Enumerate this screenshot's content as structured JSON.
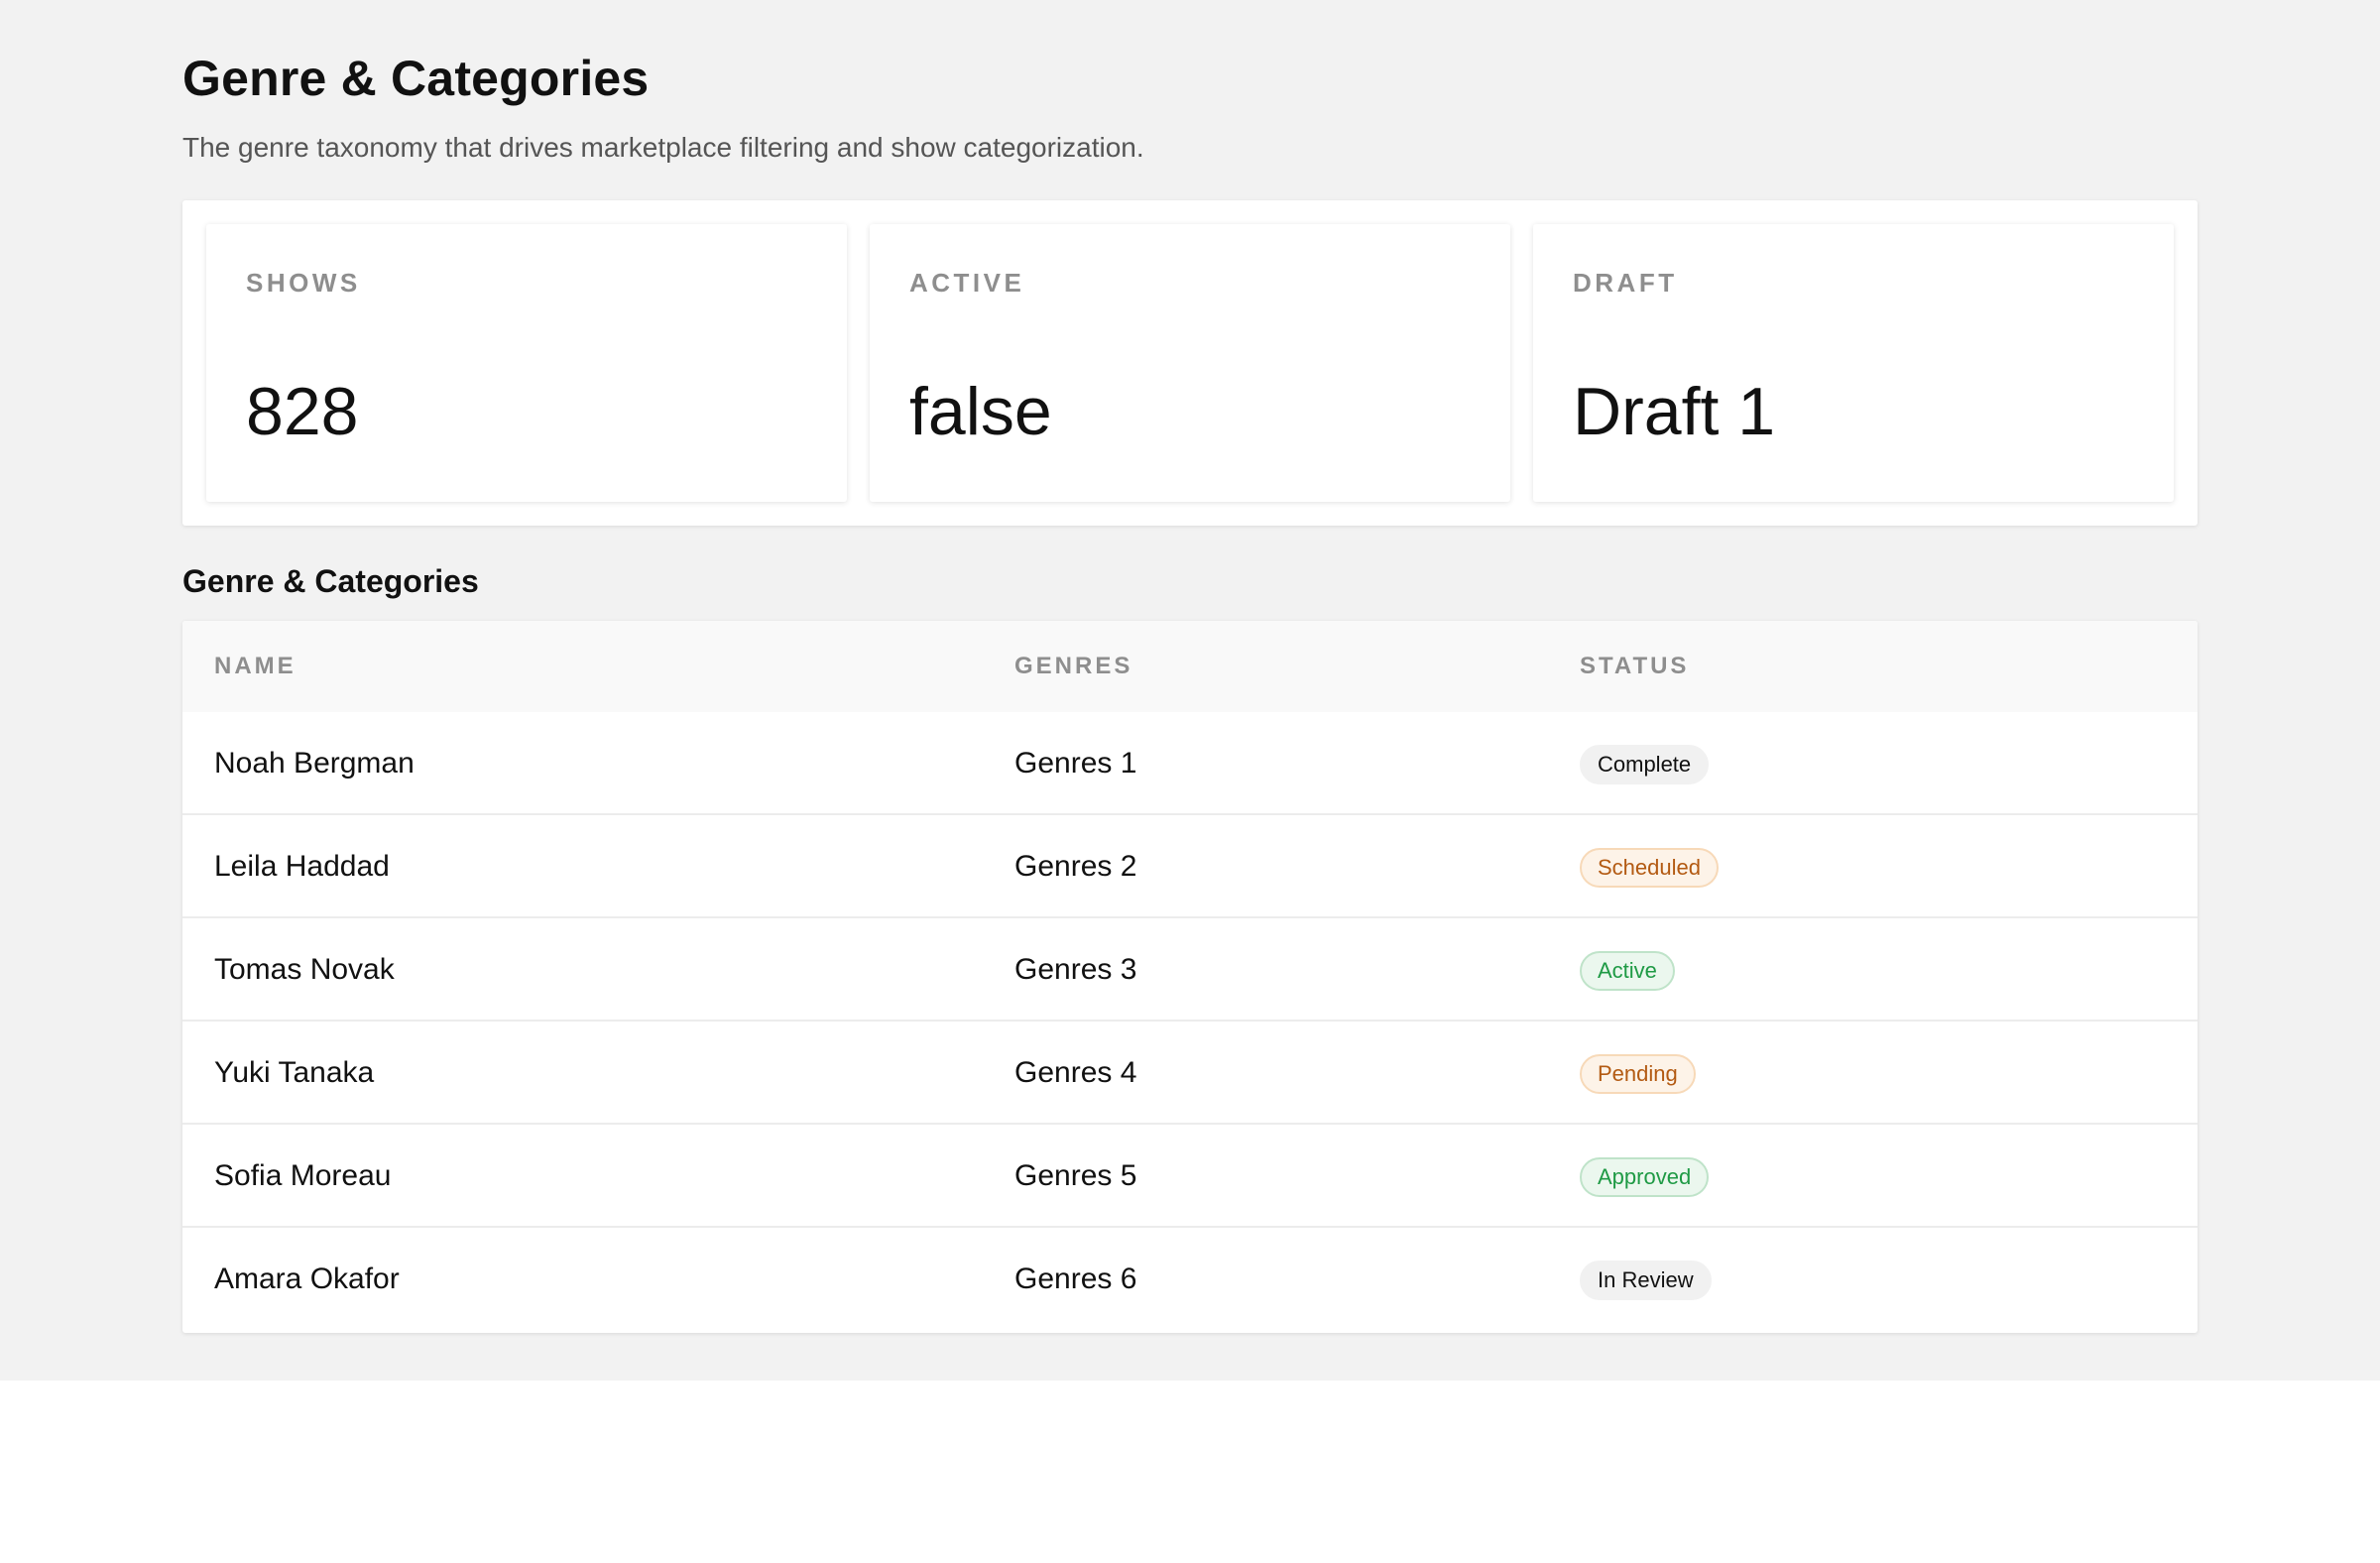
{
  "page": {
    "title": "Genre & Categories",
    "subtitle": "The genre taxonomy that drives marketplace filtering and show categorization."
  },
  "stats": [
    {
      "label": "SHOWS",
      "value": "828"
    },
    {
      "label": "ACTIVE",
      "value": "false"
    },
    {
      "label": "DRAFT",
      "value": "Draft 1"
    }
  ],
  "section": {
    "title": "Genre & Categories"
  },
  "table": {
    "columns": {
      "name": "NAME",
      "genres": "GENRES",
      "status": "STATUS"
    },
    "rows": [
      {
        "name": "Noah Bergman",
        "genres": "Genres 1",
        "status": "Complete",
        "tone": "neutral"
      },
      {
        "name": "Leila Haddad",
        "genres": "Genres 2",
        "status": "Scheduled",
        "tone": "warning"
      },
      {
        "name": "Tomas Novak",
        "genres": "Genres 3",
        "status": "Active",
        "tone": "success"
      },
      {
        "name": "Yuki Tanaka",
        "genres": "Genres 4",
        "status": "Pending",
        "tone": "warning"
      },
      {
        "name": "Sofia Moreau",
        "genres": "Genres 5",
        "status": "Approved",
        "tone": "success"
      },
      {
        "name": "Amara Okafor",
        "genres": "Genres 6",
        "status": "In Review",
        "tone": "neutral"
      }
    ]
  },
  "colors": {
    "background": "#f2f2f2",
    "surface": "#ffffff",
    "text": "#111111",
    "muted": "#8e8e8e",
    "warning_text": "#b35a12",
    "warning_bg": "#fdf3e8",
    "success_text": "#1f9a45",
    "success_bg": "#ebf7ee",
    "neutral_bg": "#f1f1f1"
  }
}
